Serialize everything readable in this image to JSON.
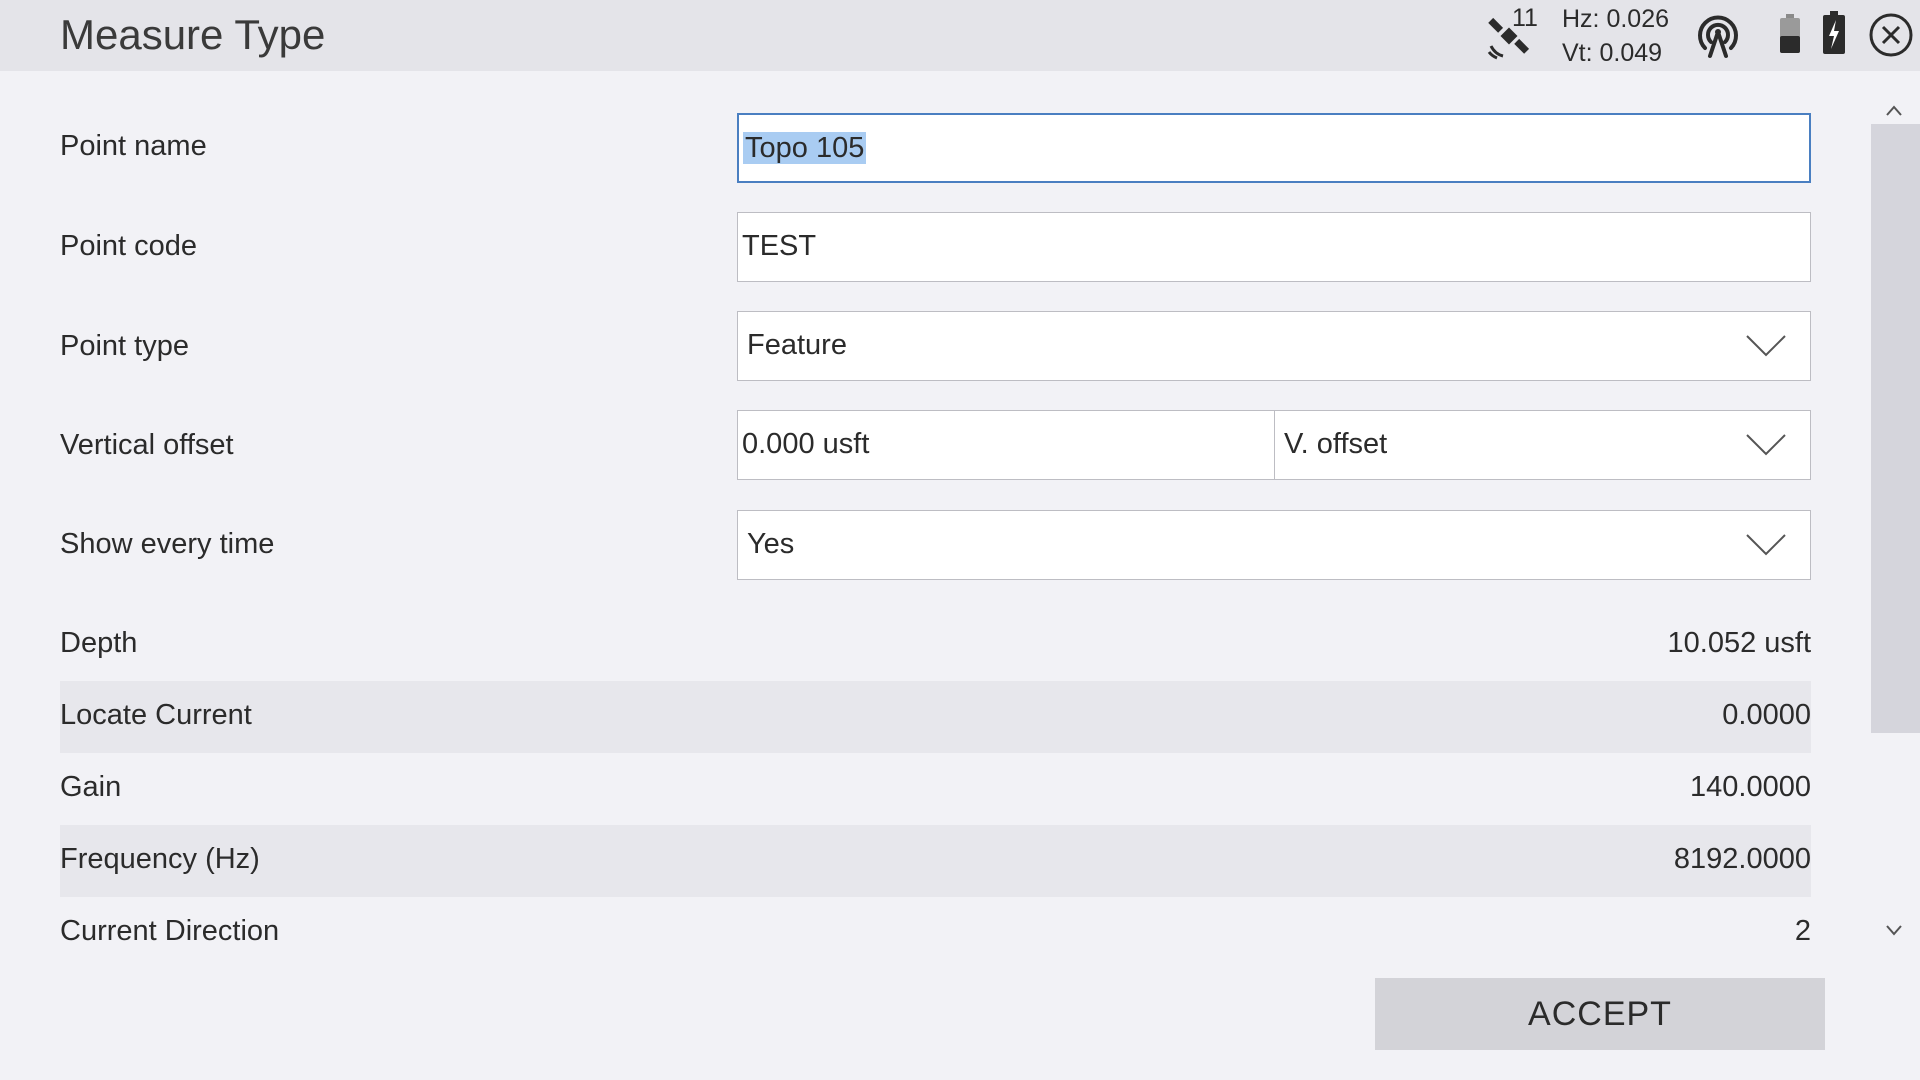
{
  "header": {
    "title": "Measure Type",
    "satellite_count": "11",
    "hz_precision": "Hz: 0.026",
    "vt_precision": "Vt: 0.049",
    "icons": [
      "satellite-icon",
      "radio-link-icon",
      "receiver-battery-icon",
      "controller-battery-icon",
      "close-icon"
    ]
  },
  "form": {
    "point_name": {
      "label": "Point name",
      "value": "Topo 105"
    },
    "point_code": {
      "label": "Point code",
      "value": "TEST"
    },
    "point_type": {
      "label": "Point type",
      "value": "Feature"
    },
    "vertical_offset": {
      "label": "Vertical offset",
      "value": "0.000 usft",
      "mode": "V. offset"
    },
    "show_every_time": {
      "label": "Show every time",
      "value": "Yes"
    }
  },
  "readings": [
    {
      "label": "Depth",
      "value": "10.052 usft"
    },
    {
      "label": "Locate Current",
      "value": "0.0000"
    },
    {
      "label": "Gain",
      "value": "140.0000"
    },
    {
      "label": "Frequency (Hz)",
      "value": "8192.0000"
    },
    {
      "label": "Current Direction",
      "value": "2"
    }
  ],
  "actions": {
    "accept_label": "ACCEPT"
  },
  "colors": {
    "selection": "#a9ccf2",
    "focus_border": "#4a7fc1",
    "header_bg": "#e4e4e9"
  }
}
